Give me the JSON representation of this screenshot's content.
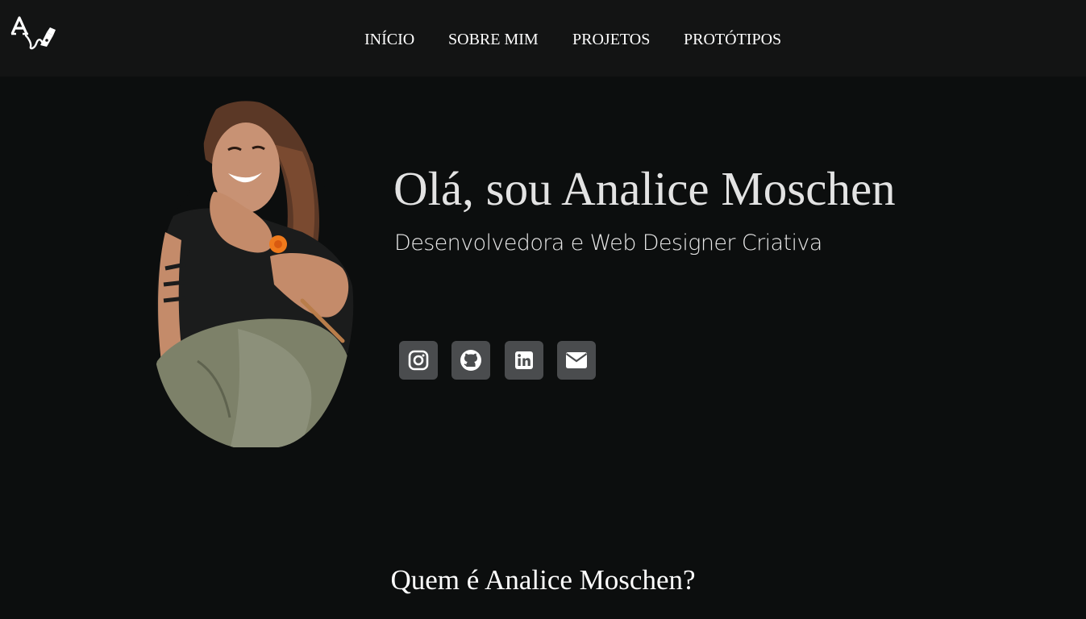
{
  "header": {
    "logo_icon": "signature-pen-logo",
    "nav": [
      {
        "label": "INÍCIO"
      },
      {
        "label": "SOBRE MIM"
      },
      {
        "label": "PROJETOS"
      },
      {
        "label": "PROTÓTIPOS"
      }
    ]
  },
  "hero": {
    "title": "Olá, sou Analice Moschen",
    "subtitle": "Desenvolvedora e Web Designer Criativa",
    "portrait_alt": "portrait-photo",
    "social": [
      {
        "icon": "instagram-icon"
      },
      {
        "icon": "github-icon"
      },
      {
        "icon": "linkedin-icon"
      },
      {
        "icon": "email-icon"
      }
    ]
  },
  "about": {
    "heading": "Quem é Analice Moschen?"
  },
  "colors": {
    "page_bg": "#0c0e0e",
    "header_bg": "#131414",
    "social_bg": "#4a4c4e",
    "text": "#ffffff"
  }
}
